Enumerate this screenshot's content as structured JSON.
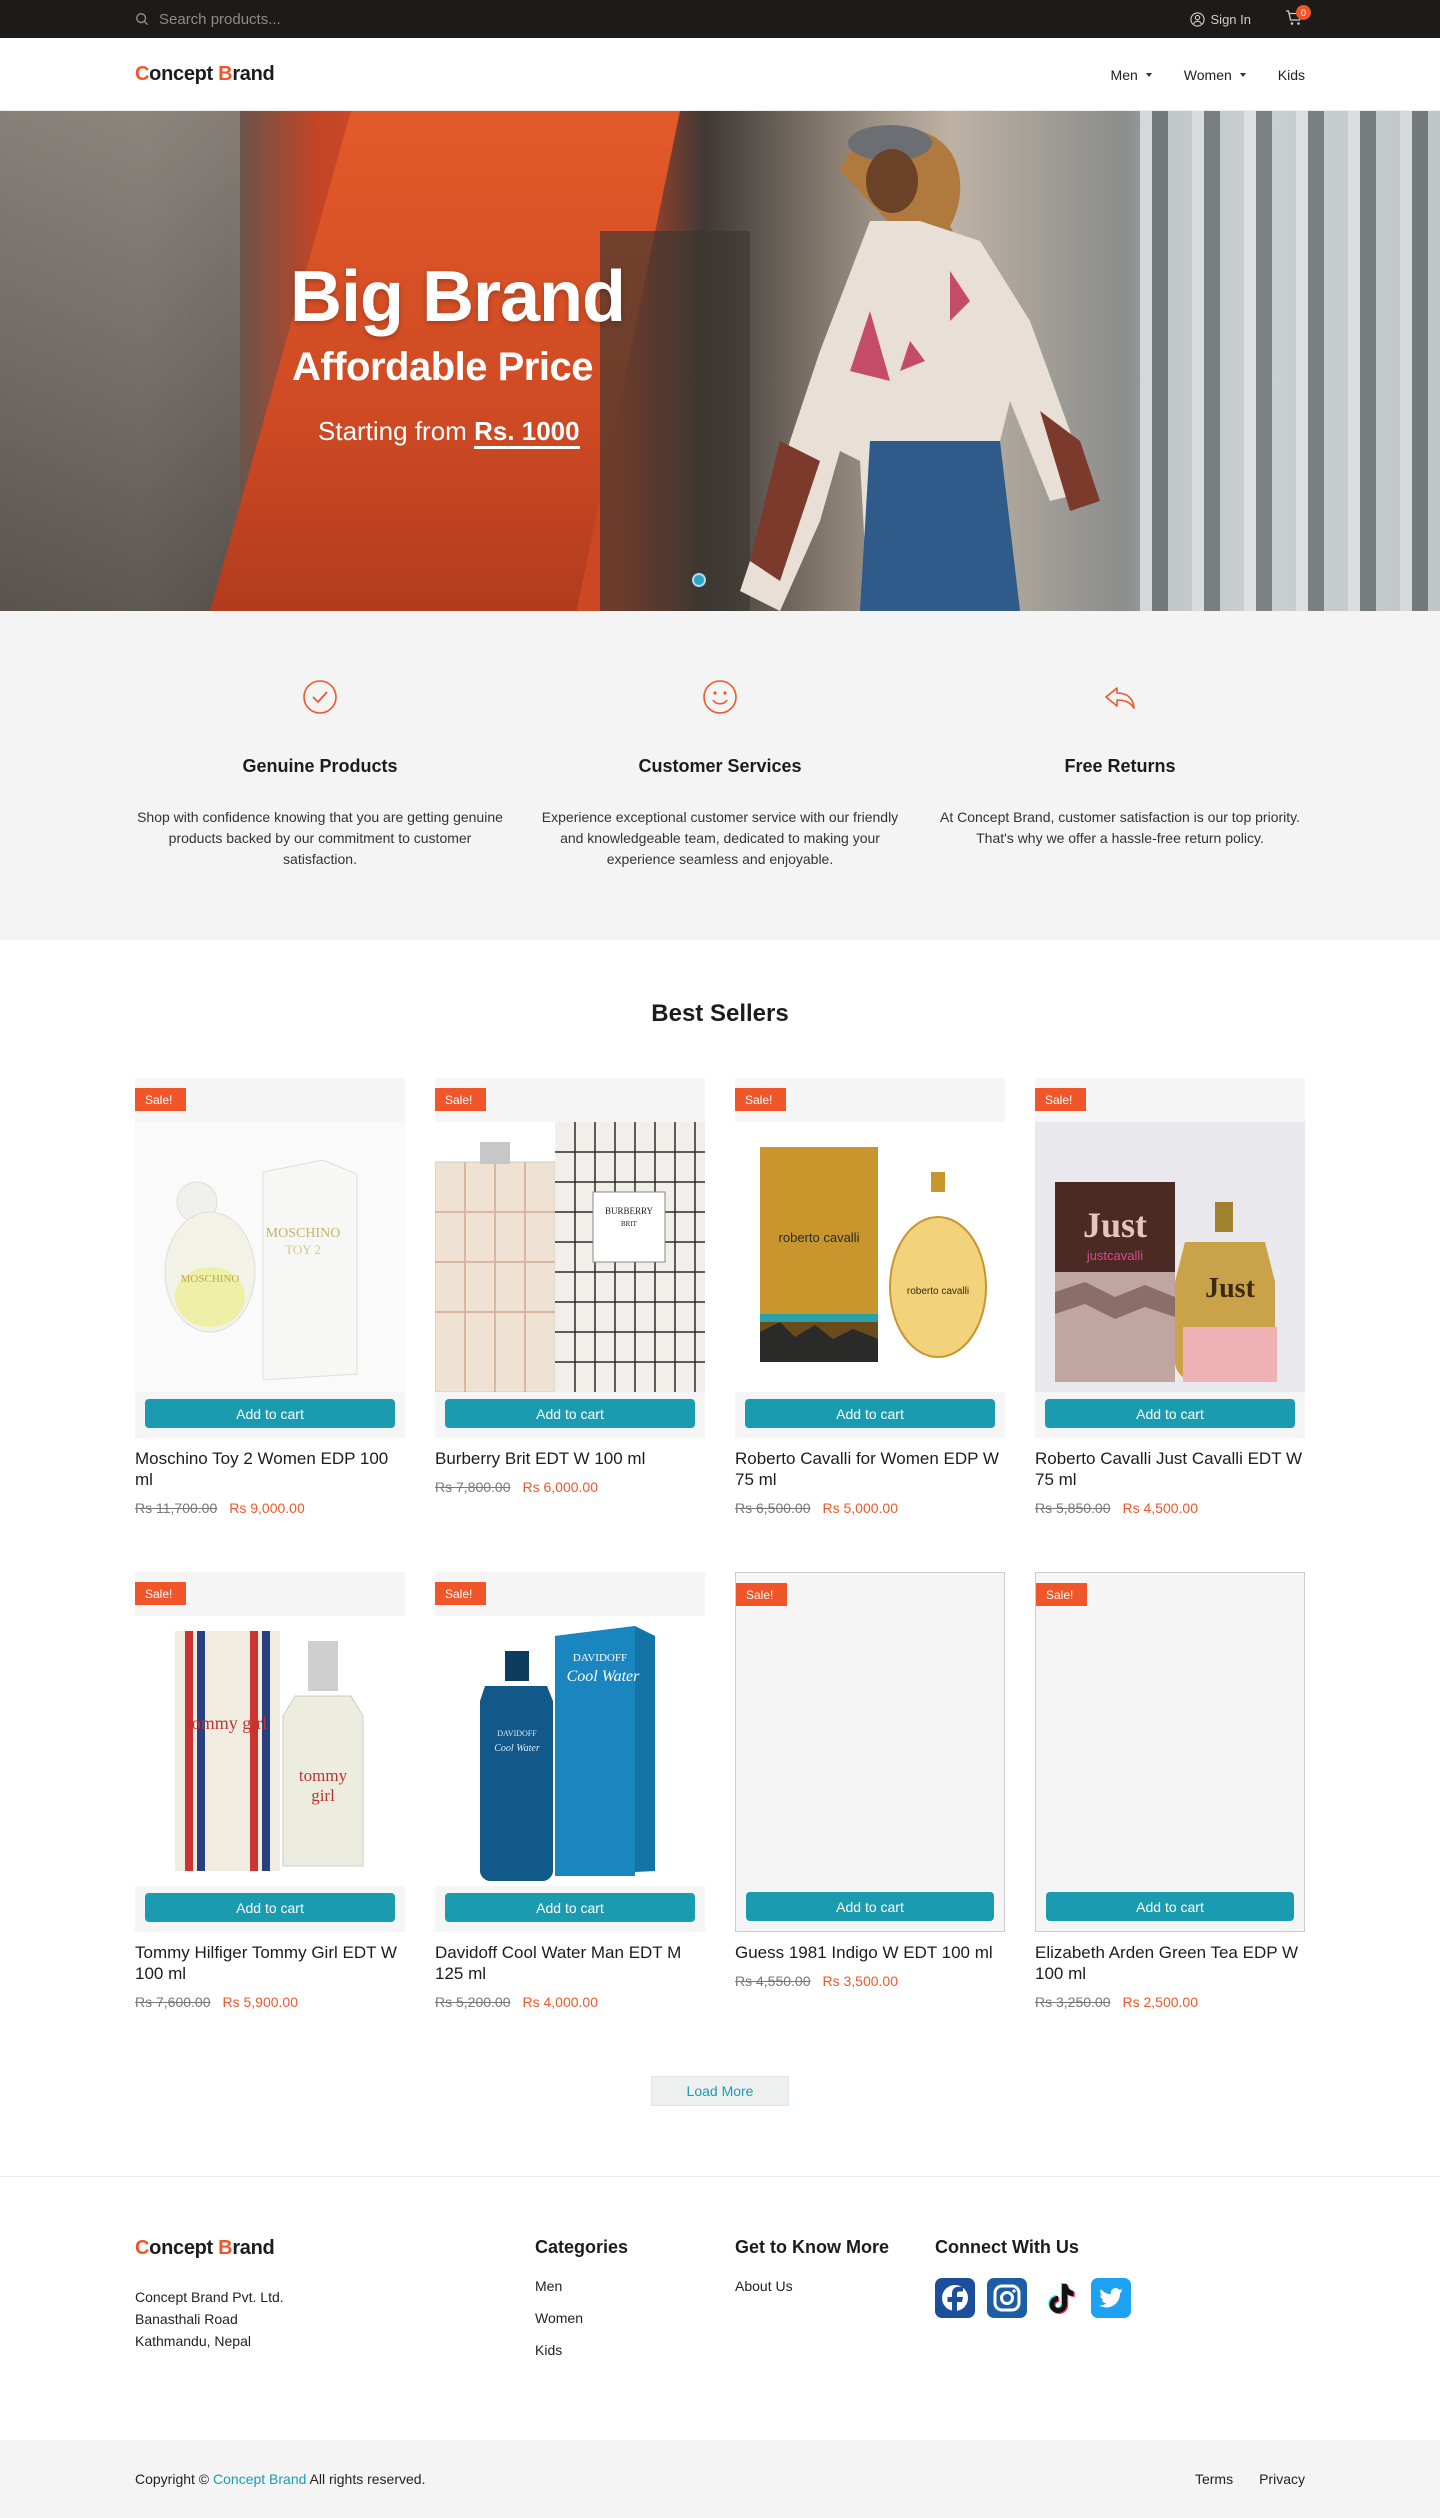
{
  "topbar": {
    "search_placeholder": "Search products...",
    "signin_label": "Sign In",
    "cart_count": "0"
  },
  "header": {
    "logo_part1_accent": "C",
    "logo_part1_rest": "oncept ",
    "logo_part2_accent": "B",
    "logo_part2_rest": "rand",
    "nav": [
      {
        "label": "Men",
        "dropdown": true
      },
      {
        "label": "Women",
        "dropdown": true
      },
      {
        "label": "Kids",
        "dropdown": false
      }
    ]
  },
  "hero": {
    "title": "Big Brand",
    "subtitle": "Affordable Price",
    "price_prefix": "Starting from ",
    "price_value": "Rs. 1000",
    "accent_color": "#f0562a"
  },
  "features": [
    {
      "icon": "check-circle-icon",
      "title": "Genuine Products",
      "text": "Shop with confidence knowing that you are getting genuine products backed by our commitment to customer satisfaction."
    },
    {
      "icon": "smile-icon",
      "title": "Customer Services",
      "text": "Experience exceptional customer service with our friendly and knowledgeable team, dedicated to making your experience seamless and enjoyable."
    },
    {
      "icon": "reply-arrow-icon",
      "title": "Free Returns",
      "text": "At Concept Brand, customer satisfaction is our top priority. That's why we offer a hassle-free return policy."
    }
  ],
  "best_sellers": {
    "title": "Best Sellers",
    "sale_label": "Sale!",
    "add_to_cart_label": "Add to cart",
    "products": [
      {
        "name": "Moschino Toy 2 Women EDP 100 ml",
        "old_price": "Rs 11,700.00",
        "new_price": "Rs 9,000.00",
        "image": "moschino-bottle"
      },
      {
        "name": "Burberry Brit EDT W 100 ml",
        "old_price": "Rs 7,800.00",
        "new_price": "Rs 6,000.00",
        "image": "burberry-bottle"
      },
      {
        "name": "Roberto Cavalli for Women EDP W 75 ml",
        "old_price": "Rs 6,500.00",
        "new_price": "Rs 5,000.00",
        "image": "cavalli-bottle"
      },
      {
        "name": "Roberto Cavalli Just Cavalli EDT W 75 ml",
        "old_price": "Rs 5,850.00",
        "new_price": "Rs 4,500.00",
        "image": "just-cavalli-bottle"
      },
      {
        "name": "Tommy Hilfiger Tommy Girl EDT W 100 ml",
        "old_price": "Rs 7,600.00",
        "new_price": "Rs 5,900.00",
        "image": "tommy-girl-bottle"
      },
      {
        "name": "Davidoff Cool Water Man EDT M 125 ml",
        "old_price": "Rs 5,200.00",
        "new_price": "Rs 4,000.00",
        "image": "cool-water-bottle"
      },
      {
        "name": "Guess 1981 Indigo W EDT 100 ml",
        "old_price": "Rs 4,550.00",
        "new_price": "Rs 3,500.00",
        "image": "broken"
      },
      {
        "name": "Elizabeth Arden Green Tea EDP W 100 ml",
        "old_price": "Rs 3,250.00",
        "new_price": "Rs 2,500.00",
        "image": "broken"
      }
    ],
    "load_more_label": "Load More"
  },
  "footer": {
    "address": [
      "Concept Brand Pvt. Ltd.",
      "Banasthali Road",
      "Kathmandu, Nepal"
    ],
    "categories_title": "Categories",
    "categories": [
      "Men",
      "Women",
      "Kids"
    ],
    "know_title": "Get to Know More",
    "know_links": [
      "About Us"
    ],
    "connect_title": "Connect With Us",
    "socials": [
      "facebook-icon",
      "instagram-icon",
      "tiktok-icon",
      "twitter-icon"
    ]
  },
  "bottombar": {
    "copyright_prefix": "Copyright © ",
    "copyright_brand": "Concept Brand",
    "copyright_suffix": " All rights reserved.",
    "links": [
      "Terms",
      "Privacy"
    ]
  }
}
